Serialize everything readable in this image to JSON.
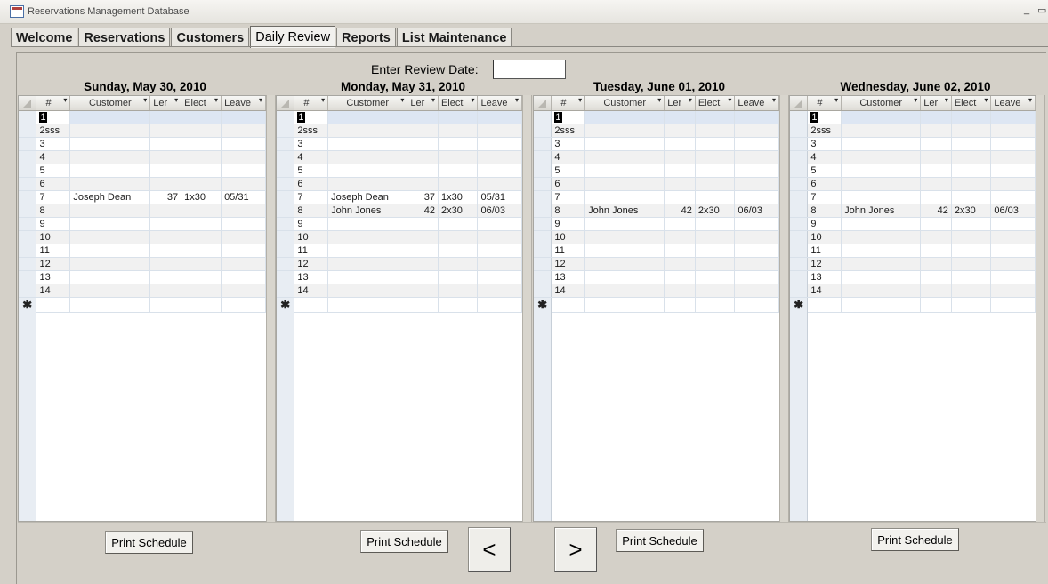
{
  "window": {
    "title": "Reservations Management Database",
    "controls": [
      "_",
      "▭"
    ]
  },
  "tabs": [
    {
      "label": "Welcome",
      "active": false
    },
    {
      "label": "Reservations",
      "active": false
    },
    {
      "label": "Customers",
      "active": false
    },
    {
      "label": "Daily Review",
      "active": true
    },
    {
      "label": "Reports",
      "active": false
    },
    {
      "label": "List Maintenance",
      "active": false
    }
  ],
  "review": {
    "prompt": "Enter Review Date:",
    "date_value": ""
  },
  "columns": [
    "#",
    "Customer",
    "Ler",
    "Elect",
    "Leave"
  ],
  "new_row_marker": "✱",
  "days": [
    {
      "title": "Sunday, May 30, 2010",
      "rows": [
        [
          "1",
          "",
          "",
          "",
          ""
        ],
        [
          "2sss",
          "",
          "",
          "",
          ""
        ],
        [
          "3",
          "",
          "",
          "",
          ""
        ],
        [
          "4",
          "",
          "",
          "",
          ""
        ],
        [
          "5",
          "",
          "",
          "",
          ""
        ],
        [
          "6",
          "",
          "",
          "",
          ""
        ],
        [
          "7",
          "Joseph Dean",
          "37",
          "1x30",
          "05/31"
        ],
        [
          "8",
          "",
          "",
          "",
          ""
        ],
        [
          "9",
          "",
          "",
          "",
          ""
        ],
        [
          "10",
          "",
          "",
          "",
          ""
        ],
        [
          "11",
          "",
          "",
          "",
          ""
        ],
        [
          "12",
          "",
          "",
          "",
          ""
        ],
        [
          "13",
          "",
          "",
          "",
          ""
        ],
        [
          "14",
          "",
          "",
          "",
          ""
        ]
      ],
      "print_label": "Print Schedule"
    },
    {
      "title": "Monday, May 31, 2010",
      "rows": [
        [
          "1",
          "",
          "",
          "",
          ""
        ],
        [
          "2sss",
          "",
          "",
          "",
          ""
        ],
        [
          "3",
          "",
          "",
          "",
          ""
        ],
        [
          "4",
          "",
          "",
          "",
          ""
        ],
        [
          "5",
          "",
          "",
          "",
          ""
        ],
        [
          "6",
          "",
          "",
          "",
          ""
        ],
        [
          "7",
          "Joseph Dean",
          "37",
          "1x30",
          "05/31"
        ],
        [
          "8",
          "John Jones",
          "42",
          "2x30",
          "06/03"
        ],
        [
          "9",
          "",
          "",
          "",
          ""
        ],
        [
          "10",
          "",
          "",
          "",
          ""
        ],
        [
          "11",
          "",
          "",
          "",
          ""
        ],
        [
          "12",
          "",
          "",
          "",
          ""
        ],
        [
          "13",
          "",
          "",
          "",
          ""
        ],
        [
          "14",
          "",
          "",
          "",
          ""
        ]
      ],
      "print_label": "Print Schedule"
    },
    {
      "title": "Tuesday, June 01, 2010",
      "rows": [
        [
          "1",
          "",
          "",
          "",
          ""
        ],
        [
          "2sss",
          "",
          "",
          "",
          ""
        ],
        [
          "3",
          "",
          "",
          "",
          ""
        ],
        [
          "4",
          "",
          "",
          "",
          ""
        ],
        [
          "5",
          "",
          "",
          "",
          ""
        ],
        [
          "6",
          "",
          "",
          "",
          ""
        ],
        [
          "7",
          "",
          "",
          "",
          ""
        ],
        [
          "8",
          "John Jones",
          "42",
          "2x30",
          "06/03"
        ],
        [
          "9",
          "",
          "",
          "",
          ""
        ],
        [
          "10",
          "",
          "",
          "",
          ""
        ],
        [
          "11",
          "",
          "",
          "",
          ""
        ],
        [
          "12",
          "",
          "",
          "",
          ""
        ],
        [
          "13",
          "",
          "",
          "",
          ""
        ],
        [
          "14",
          "",
          "",
          "",
          ""
        ]
      ],
      "print_label": "Print Schedule"
    },
    {
      "title": "Wednesday, June 02, 2010",
      "rows": [
        [
          "1",
          "",
          "",
          "",
          ""
        ],
        [
          "2sss",
          "",
          "",
          "",
          ""
        ],
        [
          "3",
          "",
          "",
          "",
          ""
        ],
        [
          "4",
          "",
          "",
          "",
          ""
        ],
        [
          "5",
          "",
          "",
          "",
          ""
        ],
        [
          "6",
          "",
          "",
          "",
          ""
        ],
        [
          "7",
          "",
          "",
          "",
          ""
        ],
        [
          "8",
          "John Jones",
          "42",
          "2x30",
          "06/03"
        ],
        [
          "9",
          "",
          "",
          "",
          ""
        ],
        [
          "10",
          "",
          "",
          "",
          ""
        ],
        [
          "11",
          "",
          "",
          "",
          ""
        ],
        [
          "12",
          "",
          "",
          "",
          ""
        ],
        [
          "13",
          "",
          "",
          "",
          ""
        ],
        [
          "14",
          "",
          "",
          "",
          ""
        ]
      ],
      "print_label": "Print Schedule"
    }
  ],
  "nav": {
    "prev_label": "<",
    "next_label": ">"
  }
}
